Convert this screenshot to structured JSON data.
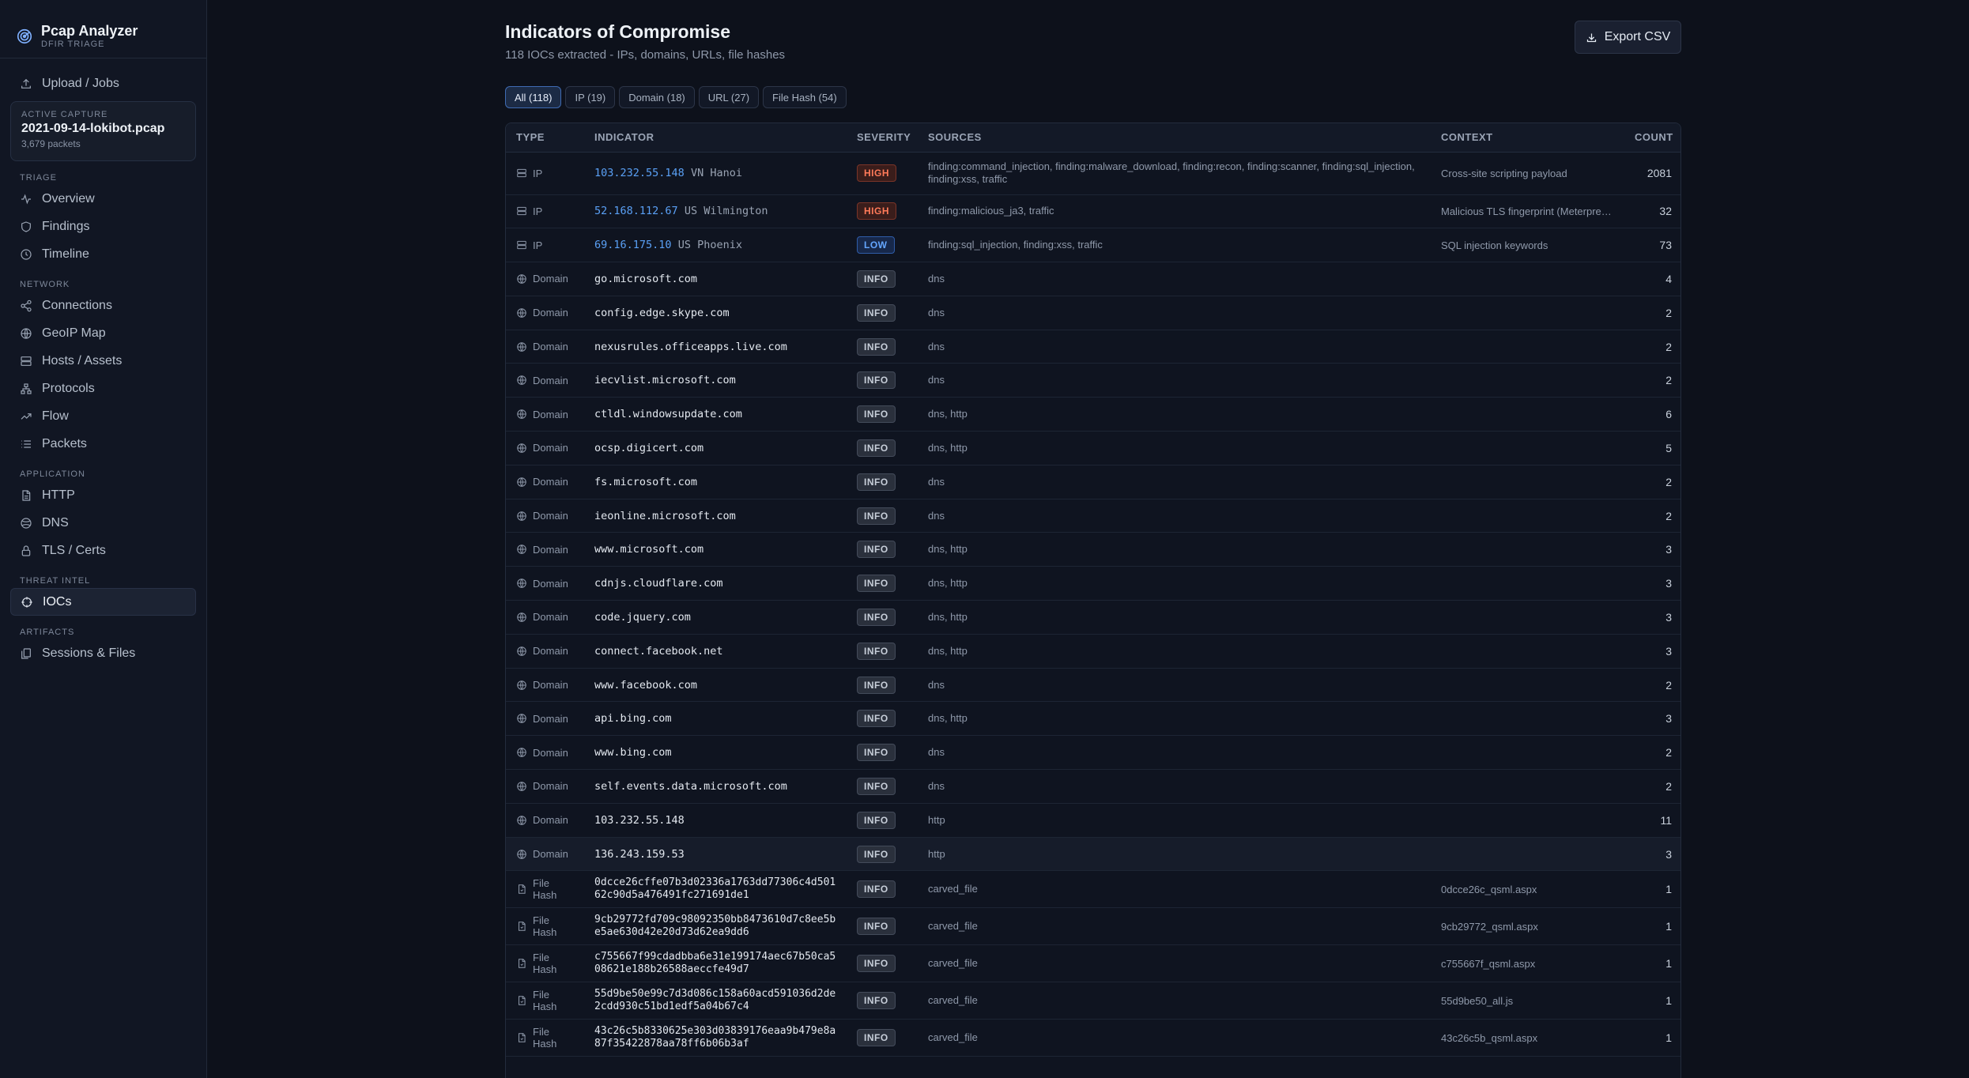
{
  "app": {
    "title": "Pcap Analyzer",
    "subtitle": "DFIR TRIAGE"
  },
  "sidebar": {
    "upload_label": "Upload / Jobs",
    "capture": {
      "label": "ACTIVE CAPTURE",
      "name": "2021-09-14-lokibot.pcap",
      "count": "3,679 packets"
    },
    "sections": {
      "triage": "TRIAGE",
      "network": "NETWORK",
      "application": "APPLICATION",
      "threat": "THREAT INTEL",
      "artifacts": "ARTIFACTS"
    },
    "items": {
      "overview": "Overview",
      "findings": "Findings",
      "timeline": "Timeline",
      "connections": "Connections",
      "geoip": "GeoIP Map",
      "hosts": "Hosts / Assets",
      "protocols": "Protocols",
      "flow": "Flow",
      "packets": "Packets",
      "http": "HTTP",
      "dns": "DNS",
      "tls": "TLS / Certs",
      "iocs": "IOCs",
      "sessions": "Sessions & Files"
    }
  },
  "page": {
    "title": "Indicators of Compromise",
    "subtitle": "118 IOCs extracted - IPs, domains, URLs, file hashes",
    "export_label": "Export CSV"
  },
  "filters": [
    "All (118)",
    "IP (19)",
    "Domain (18)",
    "URL (27)",
    "File Hash (54)"
  ],
  "table": {
    "headers": {
      "type": "TYPE",
      "indicator": "INDICATOR",
      "severity": "SEVERITY",
      "sources": "SOURCES",
      "context": "CONTEXT",
      "count": "COUNT"
    },
    "rows": [
      {
        "type": "IP",
        "icon": "server-icon",
        "indicator": "103.232.55.148",
        "geo": "VN Hanoi",
        "severity": "HIGH",
        "sources": "finding:command_injection, finding:malware_download, finding:recon, finding:scanner, finding:sql_injection, finding:xss, traffic",
        "context": "Cross-site scripting payload",
        "count": "2081"
      },
      {
        "type": "IP",
        "icon": "server-icon",
        "indicator": "52.168.112.67",
        "geo": "US Wilmington",
        "severity": "HIGH",
        "sources": "finding:malicious_ja3, traffic",
        "context": "Malicious TLS fingerprint (Meterpreter)",
        "count": "32"
      },
      {
        "type": "IP",
        "icon": "server-icon",
        "indicator": "69.16.175.10",
        "geo": "US Phoenix",
        "severity": "LOW",
        "sources": "finding:sql_injection, finding:xss, traffic",
        "context": "SQL injection keywords",
        "count": "73"
      },
      {
        "type": "Domain",
        "icon": "globe-icon",
        "indicator": "go.microsoft.com",
        "severity": "INFO",
        "sources": "dns",
        "context": "",
        "count": "4"
      },
      {
        "type": "Domain",
        "icon": "globe-icon",
        "indicator": "config.edge.skype.com",
        "severity": "INFO",
        "sources": "dns",
        "context": "",
        "count": "2"
      },
      {
        "type": "Domain",
        "icon": "globe-icon",
        "indicator": "nexusrules.officeapps.live.com",
        "severity": "INFO",
        "sources": "dns",
        "context": "",
        "count": "2"
      },
      {
        "type": "Domain",
        "icon": "globe-icon",
        "indicator": "iecvlist.microsoft.com",
        "severity": "INFO",
        "sources": "dns",
        "context": "",
        "count": "2"
      },
      {
        "type": "Domain",
        "icon": "globe-icon",
        "indicator": "ctldl.windowsupdate.com",
        "severity": "INFO",
        "sources": "dns, http",
        "context": "",
        "count": "6"
      },
      {
        "type": "Domain",
        "icon": "globe-icon",
        "indicator": "ocsp.digicert.com",
        "severity": "INFO",
        "sources": "dns, http",
        "context": "",
        "count": "5"
      },
      {
        "type": "Domain",
        "icon": "globe-icon",
        "indicator": "fs.microsoft.com",
        "severity": "INFO",
        "sources": "dns",
        "context": "",
        "count": "2"
      },
      {
        "type": "Domain",
        "icon": "globe-icon",
        "indicator": "ieonline.microsoft.com",
        "severity": "INFO",
        "sources": "dns",
        "context": "",
        "count": "2"
      },
      {
        "type": "Domain",
        "icon": "globe-icon",
        "indicator": "www.microsoft.com",
        "severity": "INFO",
        "sources": "dns, http",
        "context": "",
        "count": "3"
      },
      {
        "type": "Domain",
        "icon": "globe-icon",
        "indicator": "cdnjs.cloudflare.com",
        "severity": "INFO",
        "sources": "dns, http",
        "context": "",
        "count": "3"
      },
      {
        "type": "Domain",
        "icon": "globe-icon",
        "indicator": "code.jquery.com",
        "severity": "INFO",
        "sources": "dns, http",
        "context": "",
        "count": "3"
      },
      {
        "type": "Domain",
        "icon": "globe-icon",
        "indicator": "connect.facebook.net",
        "severity": "INFO",
        "sources": "dns, http",
        "context": "",
        "count": "3"
      },
      {
        "type": "Domain",
        "icon": "globe-icon",
        "indicator": "www.facebook.com",
        "severity": "INFO",
        "sources": "dns",
        "context": "",
        "count": "2"
      },
      {
        "type": "Domain",
        "icon": "globe-icon",
        "indicator": "api.bing.com",
        "severity": "INFO",
        "sources": "dns, http",
        "context": "",
        "count": "3"
      },
      {
        "type": "Domain",
        "icon": "globe-icon",
        "indicator": "www.bing.com",
        "severity": "INFO",
        "sources": "dns",
        "context": "",
        "count": "2"
      },
      {
        "type": "Domain",
        "icon": "globe-icon",
        "indicator": "self.events.data.microsoft.com",
        "severity": "INFO",
        "sources": "dns",
        "context": "",
        "count": "2"
      },
      {
        "type": "Domain",
        "icon": "globe-icon",
        "indicator": "103.232.55.148",
        "severity": "INFO",
        "sources": "http",
        "context": "",
        "count": "11"
      },
      {
        "type": "Domain",
        "icon": "globe-icon",
        "indicator": "136.243.159.53",
        "severity": "INFO",
        "sources": "http",
        "context": "",
        "count": "3"
      },
      {
        "type": "File Hash",
        "icon": "file-icon",
        "indicator": "0dcce26cffe07b3d02336a1763dd77306c4d50162c90d5a476491fc271691de1",
        "severity": "INFO",
        "sources": "carved_file",
        "context": "0dcce26c_qsml.aspx",
        "count": "1"
      },
      {
        "type": "File Hash",
        "icon": "file-icon",
        "indicator": "9cb29772fd709c98092350bb8473610d7c8ee5be5ae630d42e20d73d62ea9dd6",
        "severity": "INFO",
        "sources": "carved_file",
        "context": "9cb29772_qsml.aspx",
        "count": "1"
      },
      {
        "type": "File Hash",
        "icon": "file-icon",
        "indicator": "c755667f99cdadbba6e31e199174aec67b50ca508621e188b26588aeccfe49d7",
        "severity": "INFO",
        "sources": "carved_file",
        "context": "c755667f_qsml.aspx",
        "count": "1"
      },
      {
        "type": "File Hash",
        "icon": "file-icon",
        "indicator": "55d9be50e99c7d3d086c158a60acd591036d2de2cdd930c51bd1edf5a04b67c4",
        "severity": "INFO",
        "sources": "carved_file",
        "context": "55d9be50_all.js",
        "count": "1"
      },
      {
        "type": "File Hash",
        "icon": "file-icon",
        "indicator": "43c26c5b8330625e303d03839176eaa9b479e8a87f35422878aa78ff6b06b3af",
        "severity": "INFO",
        "sources": "carved_file",
        "context": "43c26c5b_qsml.aspx",
        "count": "1"
      }
    ]
  }
}
